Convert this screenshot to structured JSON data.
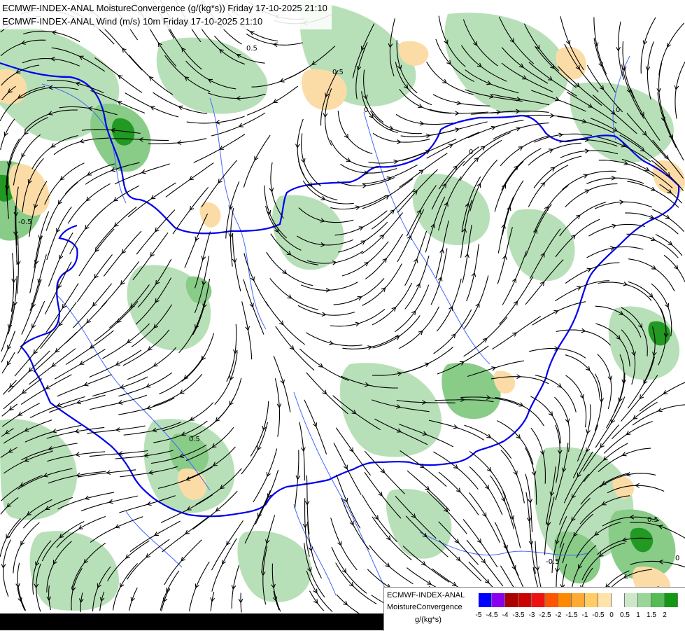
{
  "title": {
    "line1": "ECMWF-INDEX-ANAL MoistureConvergence (g/(kg*s)) Friday 17-10-2025 21:10",
    "line2": "ECMWF-INDEX-ANAL Wind (m/s) 10m Friday 17-10-2025 21:10"
  },
  "contour_labels": [
    "0.5",
    "0.5",
    "-0.5",
    "0",
    "0",
    "0",
    "0.5",
    "-0.5",
    "0.5",
    "0"
  ],
  "legend": {
    "line1": "ECMWF-INDEX-ANAL",
    "line2": "MoistureConvergence",
    "line3": "g/(kg*s)",
    "ticks": [
      "-5",
      "-4.5",
      "-4",
      "-3.5",
      "-3",
      "-2.5",
      "-2",
      "-1.5",
      "-1",
      "-0.5",
      "0",
      "0.5",
      "1",
      "1.5",
      "2"
    ],
    "colors": [
      "#0000ff",
      "#8800ee",
      "#aa0000",
      "#cc0000",
      "#ee1111",
      "#ff5500",
      "#ff8800",
      "#ffaa33",
      "#ffcc66",
      "#ffe3a8",
      "#ffffff",
      "#cce8c8",
      "#99d699",
      "#55bb55",
      "#119911"
    ]
  },
  "colors": {
    "border": "#0000ee",
    "river": "#4466ff",
    "streamline": "#000000",
    "converge_light": "#b8e0b8",
    "converge_mid": "#88cc88",
    "converge_strong": "#229922",
    "diverge": "#fcdca6"
  }
}
